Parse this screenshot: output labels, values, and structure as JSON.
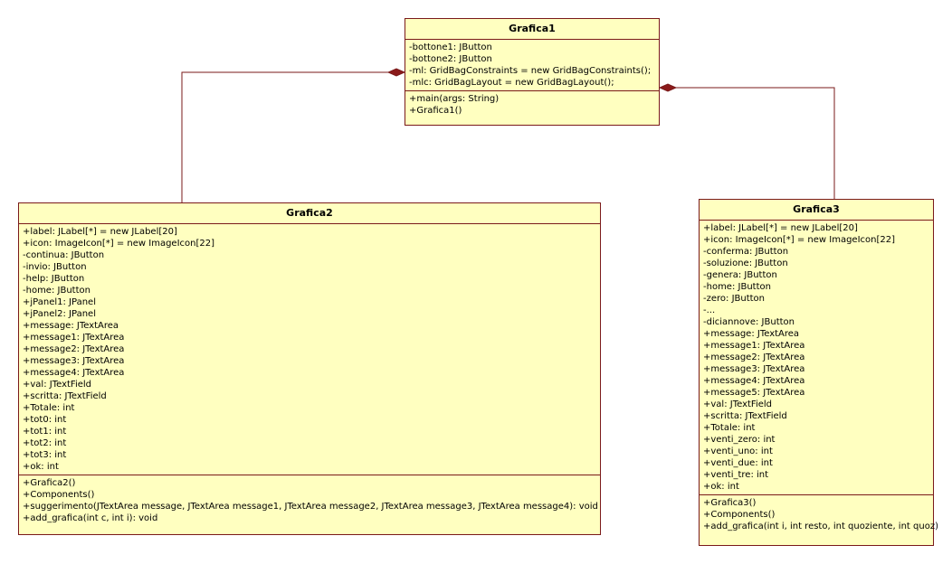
{
  "classes": {
    "grafica1": {
      "name": "Grafica1",
      "attributes": [
        "-bottone1: JButton",
        "-bottone2: JButton",
        "-ml: GridBagConstraints = new GridBagConstraints();",
        "-mlc: GridBagLayout = new GridBagLayout();"
      ],
      "operations": [
        "+main(args: String)",
        "+Grafica1()"
      ]
    },
    "grafica2": {
      "name": "Grafica2",
      "attributes": [
        "+label: JLabel[*] = new JLabel[20]",
        "+icon: ImageIcon[*] = new ImageIcon[22]",
        "-continua: JButton",
        "-invio: JButton",
        "-help: JButton",
        "-home: JButton",
        "+jPanel1: JPanel",
        "+jPanel2: JPanel",
        "+message: JTextArea",
        "+message1: JTextArea",
        "+message2: JTextArea",
        "+message3: JTextArea",
        "+message4: JTextArea",
        "+val: JTextField",
        "+scritta: JTextField",
        "+Totale: int",
        "+tot0: int",
        "+tot1: int",
        "+tot2: int",
        "+tot3: int",
        "+ok: int"
      ],
      "operations": [
        "+Grafica2()",
        "+Components()",
        "+suggerimento(JTextArea message, JTextArea message1, JTextArea message2, JTextArea message3, JTextArea message4): void",
        "+add_grafica(int c, int i): void"
      ]
    },
    "grafica3": {
      "name": "Grafica3",
      "attributes": [
        "+label: JLabel[*] = new JLabel[20]",
        "+icon: ImageIcon[*] = new ImageIcon[22]",
        "-conferma: JButton",
        "-soluzione: JButton",
        "-genera: JButton",
        "-home: JButton",
        "-zero: JButton",
        "-...",
        "-diciannove: JButton",
        "+message: JTextArea",
        "+message1: JTextArea",
        "+message2: JTextArea",
        "+message3: JTextArea",
        "+message4: JTextArea",
        "+message5: JTextArea",
        "+val: JTextField",
        "+scritta: JTextField",
        "+Totale: int",
        "+venti_zero: int",
        "+venti_uno: int",
        "+venti_due: int",
        "+venti_tre: int",
        "+ok: int"
      ],
      "operations": [
        "+Grafica3()",
        "+Components()",
        "+add_grafica(int i, int resto, int quoziente, int quoz)"
      ]
    }
  },
  "relationships": [
    {
      "type": "composition",
      "whole": "Grafica1",
      "part": "Grafica2"
    },
    {
      "type": "composition",
      "whole": "Grafica1",
      "part": "Grafica3"
    }
  ],
  "colors": {
    "class_fill": "#ffffc0",
    "class_border": "#7a1a1a",
    "link_line": "#7a1a1a",
    "diamond_fill": "#8b1a1a"
  }
}
